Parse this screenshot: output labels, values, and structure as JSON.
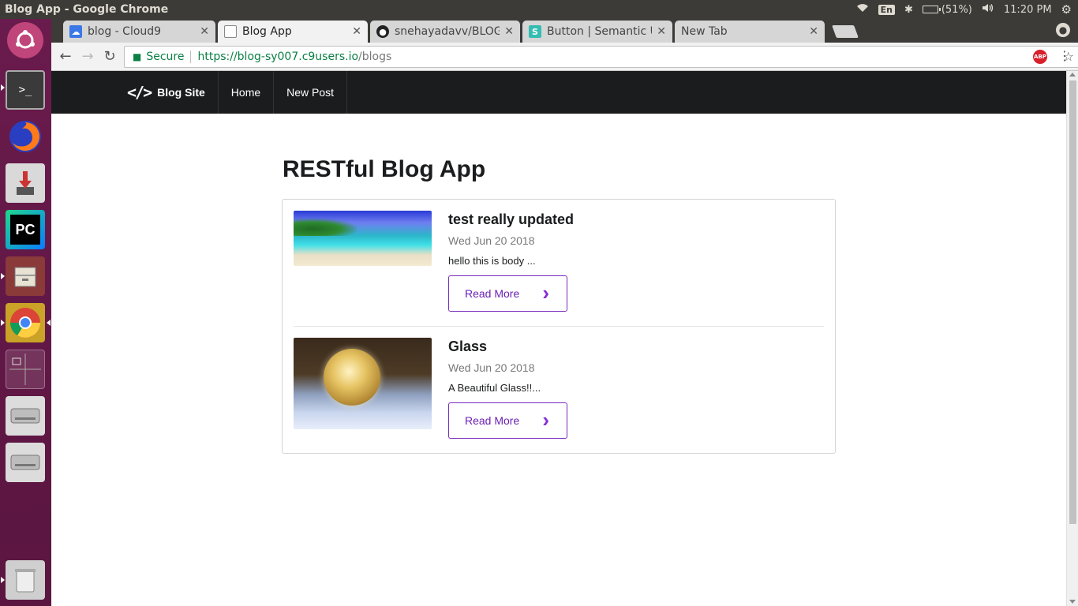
{
  "os": {
    "window_title": "Blog App - Google Chrome",
    "lang": "En",
    "battery": "(51%)",
    "battery_level": 0.51,
    "clock": "11:20 PM"
  },
  "launcher": {
    "items": [
      "ubuntu-dash",
      "terminal",
      "firefox",
      "install",
      "pycharm",
      "files",
      "chrome",
      "workspace-switcher",
      "drive-1",
      "drive-2",
      "trash"
    ],
    "pycharm_label": "PC"
  },
  "tabs": [
    {
      "label": "blog - Cloud9",
      "active": false
    },
    {
      "label": "Blog App",
      "active": true
    },
    {
      "label": "snehayadavv/BLOG",
      "active": false
    },
    {
      "label": "Button | Semantic UI",
      "active": false
    },
    {
      "label": "New Tab",
      "active": false
    }
  ],
  "omnibox": {
    "secure_label": "Secure",
    "url_scheme_host": "https://blog-sy007.c9users.io",
    "url_path": "/blogs"
  },
  "abp_label": "ABP",
  "site_nav": {
    "brand": "Blog Site",
    "links": [
      "Home",
      "New Post"
    ]
  },
  "page": {
    "title": "RESTful Blog App",
    "posts": [
      {
        "title": "test really updated",
        "date": "Wed Jun 20 2018",
        "body": "hello this is body ...",
        "read_more": "Read More"
      },
      {
        "title": "Glass",
        "date": "Wed Jun 20 2018",
        "body": "A Beautiful Glass!!...",
        "read_more": "Read More"
      }
    ]
  },
  "colors": {
    "launcher": "#6a1b4d",
    "nav_bg": "#1b1c1d",
    "accent": "#7a2bbf",
    "secure": "#0b8043"
  }
}
